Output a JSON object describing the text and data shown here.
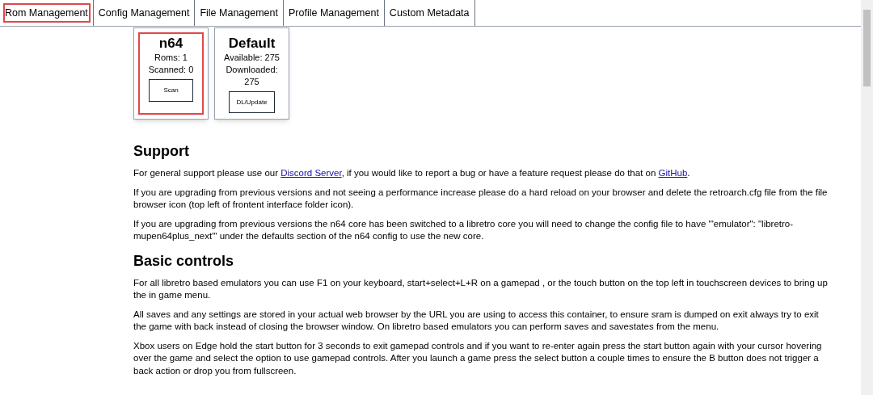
{
  "tabs": [
    {
      "label": "Rom Management",
      "highlighted": true
    },
    {
      "label": "Config Management",
      "highlighted": false
    },
    {
      "label": "File Management",
      "highlighted": false
    },
    {
      "label": "Profile Management",
      "highlighted": false
    },
    {
      "label": "Custom Metadata",
      "highlighted": false
    }
  ],
  "cards": [
    {
      "title": "n64",
      "lines": [
        "Roms: 1",
        "Scanned: 0"
      ],
      "button": "Scan",
      "highlighted": true
    },
    {
      "title": "Default",
      "lines": [
        "Available: 275",
        "Downloaded: 275"
      ],
      "button": "DL/Update",
      "highlighted": false
    }
  ],
  "sections": [
    {
      "heading": "Support",
      "paragraphs": [
        [
          {
            "kind": "text",
            "text": "For general support please use our "
          },
          {
            "kind": "link",
            "text": "Discord Server"
          },
          {
            "kind": "text",
            "text": ", if you would like to report a bug or have a feature request please do that on "
          },
          {
            "kind": "link",
            "text": "GitHub"
          },
          {
            "kind": "text",
            "text": "."
          }
        ],
        [
          {
            "kind": "text",
            "text": "If you are upgrading from previous versions and not seeing a performance increase please do a hard reload on your browser and delete the retroarch.cfg file from the file browser icon (top left of frontent interface folder icon)."
          }
        ],
        [
          {
            "kind": "text",
            "text": "If you are upgrading from previous versions the n64 core has been switched to a libretro core you will need to change the config file to have '\"emulator\": \"libretro-mupen64plus_next\"' under the defaults section of the n64 config to use the new core."
          }
        ]
      ]
    },
    {
      "heading": "Basic controls",
      "paragraphs": [
        [
          {
            "kind": "text",
            "text": "For all libretro based emulators you can use F1 on your keyboard, start+select+L+R on a gamepad , or the touch button on the top left in touchscreen devices to bring up the in game menu."
          }
        ],
        [
          {
            "kind": "text",
            "text": "All saves and any settings are stored in your actual web browser by the URL you are using to access this container, to ensure sram is dumped on exit always try to exit the game with back instead of closing the browser window. On libretro based emulators you can perform saves and savestates from the menu."
          }
        ],
        [
          {
            "kind": "text",
            "text": "Xbox users on Edge hold the start button for 3 seconds to exit gamepad controls and if you want to re-enter again press the start button again with your cursor hovering over the game and select the option to use gamepad controls. After you launch a game press the select button a couple times to ensure the B button does not trigger a back action or drop you from fullscreen."
          }
        ]
      ]
    }
  ]
}
